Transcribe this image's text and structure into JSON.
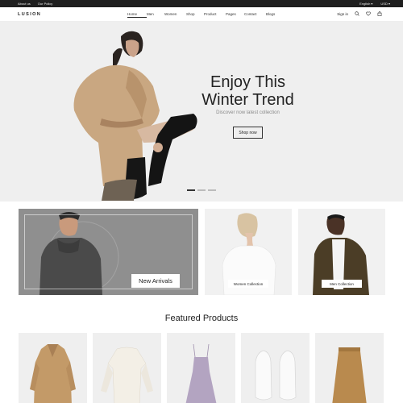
{
  "topbar": {
    "links": [
      "About us",
      "Our Policy"
    ],
    "language": "English",
    "currency": "USD"
  },
  "header": {
    "logo": "LUSION",
    "nav": [
      "Home",
      "Men",
      "Women",
      "Shop",
      "Product",
      "Pages",
      "Contact",
      "Blogs"
    ],
    "signin": "Sign in"
  },
  "hero": {
    "title_line1": "Enjoy This",
    "title_line2": "Winter Trend",
    "subtitle": "Discover now latest collection",
    "button": "Shop now",
    "slide_count": 3,
    "active_slide": 1
  },
  "banners": [
    {
      "label": "New Arrivals"
    },
    {
      "label": "Women Collection"
    },
    {
      "label": "Men Collection"
    }
  ],
  "featured": {
    "title": "Featured Products"
  },
  "colors": {
    "topbar": "#1f1f1f",
    "hero_bg": "#efefef",
    "accent": "#222222"
  }
}
